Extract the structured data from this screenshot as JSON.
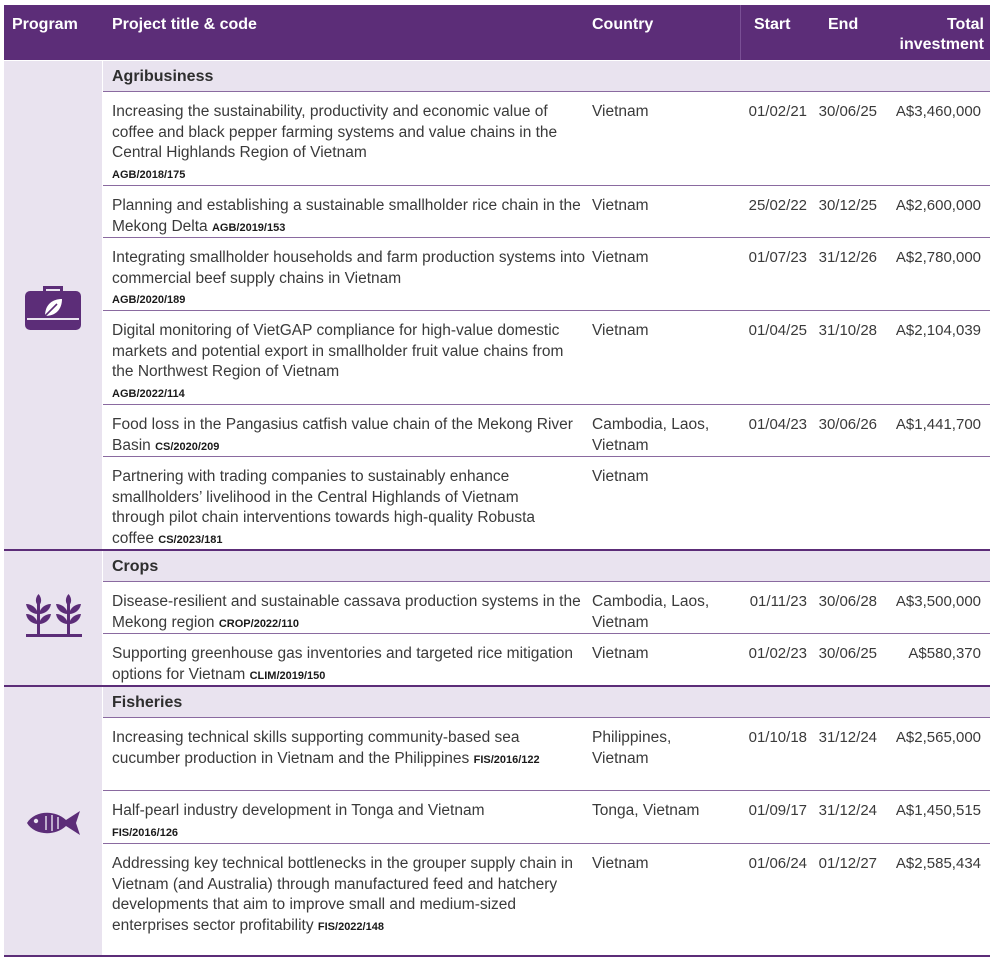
{
  "header": {
    "program": "Program",
    "title": "Project title & code",
    "country": "Country",
    "start": "Start",
    "end": "End",
    "total": "Total investment"
  },
  "sections": [
    {
      "name": "Agribusiness",
      "icon": "briefcase-leaf-icon",
      "rows": [
        {
          "title": "Increasing the sustainability, productivity and economic value of coffee and black pepper farming systems and value chains in the Central Highlands Region of Vietnam",
          "code": "AGB/2018/175",
          "country": "Vietnam",
          "start": "01/02/21",
          "end": "30/06/25",
          "total": "A$3,460,000"
        },
        {
          "title": "Planning and establishing a sustainable smallholder rice chain in the Mekong Delta",
          "code": "AGB/2019/153",
          "country": "Vietnam",
          "start": "25/02/22",
          "end": "30/12/25",
          "total": "A$2,600,000"
        },
        {
          "title": "Integrating smallholder households and farm production systems into commercial beef supply chains in Vietnam",
          "code": "AGB/2020/189",
          "country": "Vietnam",
          "start": "01/07/23",
          "end": "31/12/26",
          "total": "A$2,780,000"
        },
        {
          "title": "Digital monitoring of VietGAP compliance for high-value domestic markets and potential export in smallholder fruit value chains from the Northwest Region of Vietnam",
          "code": "AGB/2022/114",
          "country": "Vietnam",
          "start": "01/04/25",
          "end": "31/10/28",
          "total": "A$2,104,039"
        },
        {
          "title": "Food loss in the Pangasius catfish value chain of the Mekong River Basin",
          "code": "CS/2020/209",
          "country": "Cambodia, Laos, Vietnam",
          "start": "01/04/23",
          "end": "30/06/26",
          "total": "A$1,441,700"
        },
        {
          "title": "Partnering with trading companies to sustainably enhance smallholders’ livelihood in the Central Highlands of Vietnam through pilot chain interventions towards high-quality Robusta coffee",
          "code": "CS/2023/181",
          "country": "Vietnam",
          "start": "",
          "end": "",
          "total": ""
        }
      ]
    },
    {
      "name": "Crops",
      "icon": "wheat-plants-icon",
      "rows": [
        {
          "title": "Disease-resilient and sustainable cassava production systems in the Mekong region",
          "code": "CROP/2022/110",
          "country": "Cambodia, Laos, Vietnam",
          "start": "01/11/23",
          "end": "30/06/28",
          "total": "A$3,500,000"
        },
        {
          "title": "Supporting greenhouse gas inventories and targeted rice mitigation options for Vietnam",
          "code": "CLIM/2019/150",
          "country": "Vietnam",
          "start": "01/02/23",
          "end": "30/06/25",
          "total": "A$580,370"
        }
      ]
    },
    {
      "name": "Fisheries",
      "icon": "fish-icon",
      "rows": [
        {
          "title": "Increasing technical skills supporting community-based sea cucumber production in Vietnam and the Philippines",
          "code": "FIS/2016/122",
          "country": "Philippines, Vietnam",
          "start": "01/10/18",
          "end": "31/12/24",
          "total": "A$2,565,000"
        },
        {
          "title": "Half-pearl industry development in Tonga and Vietnam",
          "code": "FIS/2016/126",
          "country": "Tonga, Vietnam",
          "start": "01/09/17",
          "end": "31/12/24",
          "total": "A$1,450,515"
        },
        {
          "title": "Addressing key technical bottlenecks in the grouper supply chain in Vietnam (and Australia) through manufactured feed and hatchery developments that aim to improve small and medium-sized enterprises sector profitability",
          "code": "FIS/2022/148",
          "country": "Vietnam",
          "start": "01/06/24",
          "end": "01/12/27",
          "total": "A$2,585,434"
        }
      ]
    }
  ],
  "colors": {
    "header": "#5c2d78",
    "band": "#e9e3ef",
    "divider": "#8a6aa0"
  }
}
